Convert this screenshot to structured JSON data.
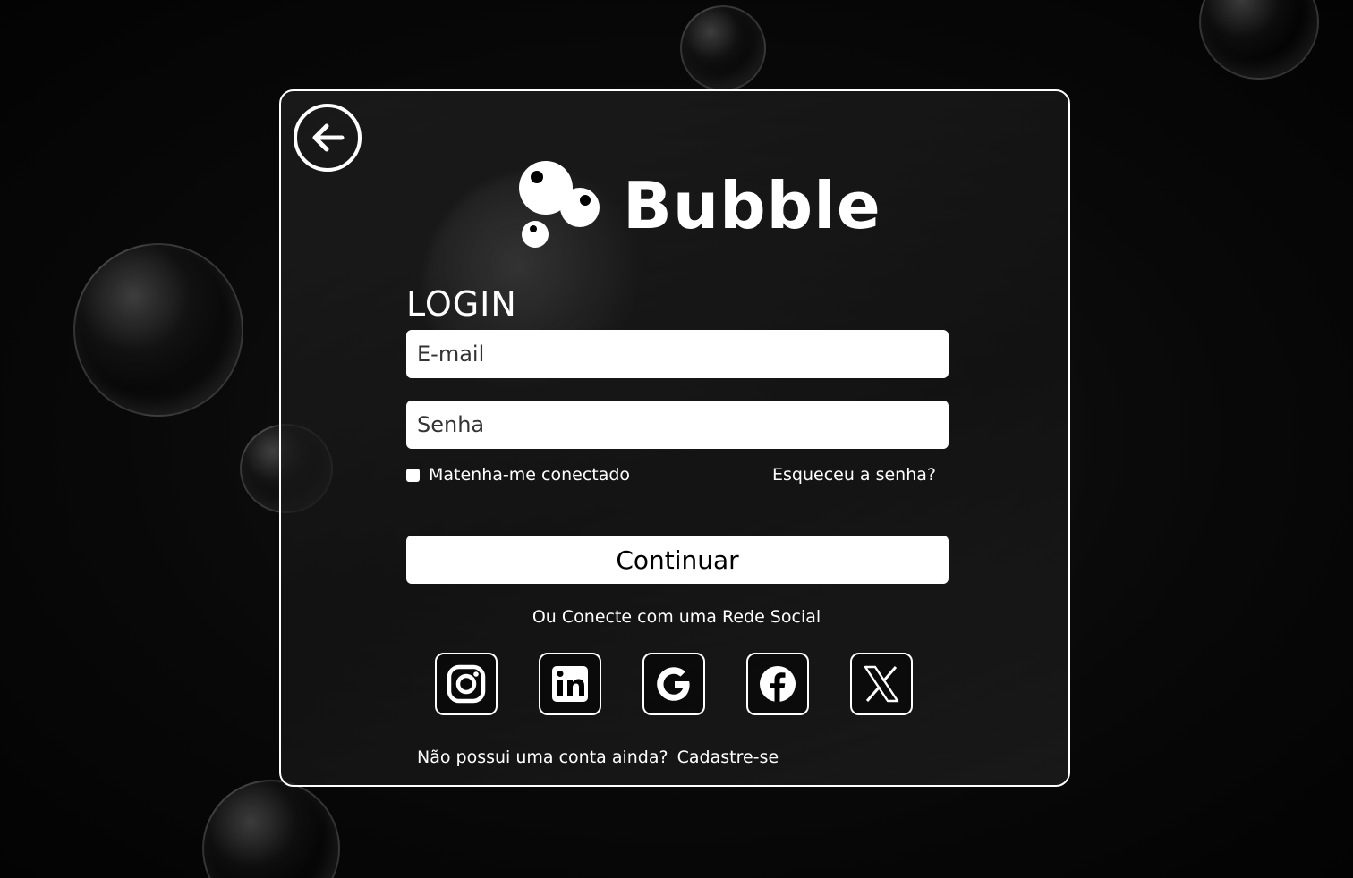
{
  "brand": {
    "name": "Bubble"
  },
  "login": {
    "title": "LOGIN",
    "email_placeholder": "E-mail",
    "password_placeholder": "Senha",
    "remember_label": "Matenha-me conectado",
    "forgot_label": "Esqueceu a senha?",
    "continue_label": "Continuar",
    "social_caption": "Ou Conecte com uma Rede Social",
    "signup_prompt": "Não possui uma conta ainda?",
    "signup_link": "Cadastre-se"
  },
  "social": [
    {
      "icon": "instagram-icon"
    },
    {
      "icon": "linkedin-icon"
    },
    {
      "icon": "google-icon"
    },
    {
      "icon": "facebook-icon"
    },
    {
      "icon": "x-icon"
    }
  ],
  "colors": {
    "background": "#070707",
    "card_border": "#ffffff",
    "field": "#ffffff",
    "text": "#ffffff"
  }
}
